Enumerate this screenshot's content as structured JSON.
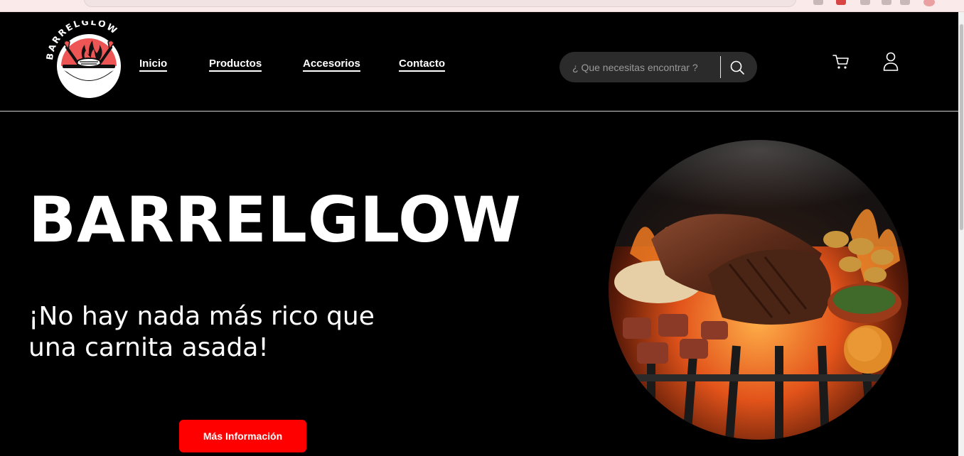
{
  "brand": {
    "logo_text": "BARRELGLOW",
    "colors": {
      "accent": "#fe0000",
      "logo_red": "#ee5555",
      "background": "#000000"
    }
  },
  "nav": {
    "items": [
      {
        "label": "Inicio"
      },
      {
        "label": "Productos"
      },
      {
        "label": "Accesorios"
      },
      {
        "label": "Contacto"
      }
    ]
  },
  "search": {
    "placeholder": "¿ Que necesitas encontrar ?",
    "button_icon": "search-icon"
  },
  "header_icons": [
    "cart-icon",
    "user-icon"
  ],
  "hero": {
    "title": "BARRELGLOW",
    "subtitle": "¡No hay nada más rico que una carnita asada!",
    "cta_label": "Más Información",
    "image": "grilled-meat-on-fire-image"
  }
}
